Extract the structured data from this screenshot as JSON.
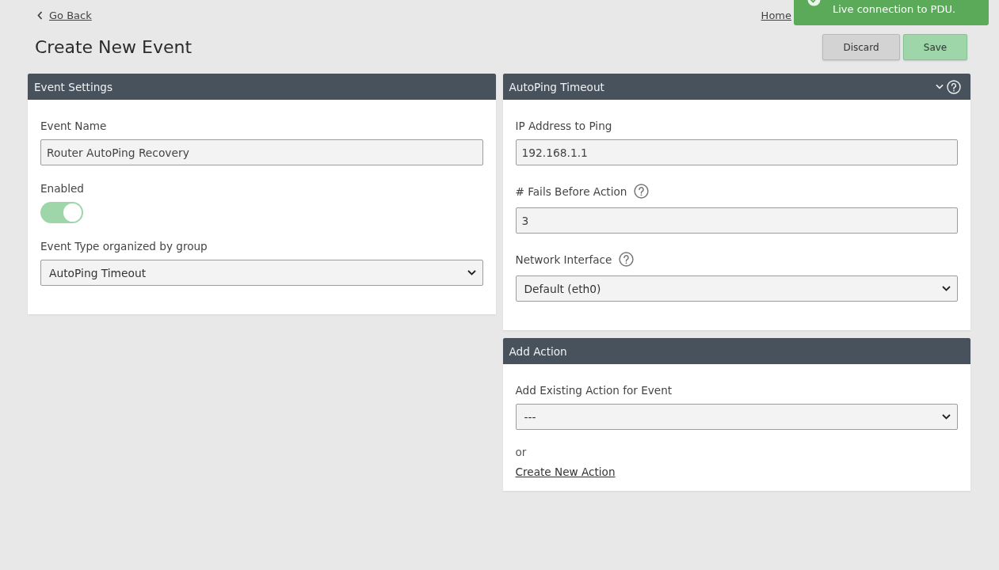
{
  "back_link": {
    "label": "Go Back"
  },
  "breadcrumb": [
    {
      "label": "Home"
    }
  ],
  "toast": {
    "kind": "success",
    "message": "Live connection to PDU."
  },
  "page_title": "Create New Event",
  "buttons": [
    {
      "kind": "secondary",
      "label": "Discard"
    },
    {
      "kind": "primary",
      "label": "Save"
    }
  ],
  "columns": [
    {
      "panels": [
        {
          "title": "Event Settings",
          "collapsible": false,
          "help": false,
          "fields": [
            {
              "kind": "text",
              "label": "Event Name",
              "help": false,
              "value": "Router AutoPing Recovery"
            },
            {
              "kind": "toggle",
              "label": "Enabled",
              "help": false,
              "on": true
            },
            {
              "kind": "select",
              "label": "Event Type organized by group",
              "help": false,
              "value": "AutoPing Timeout"
            }
          ]
        }
      ]
    },
    {
      "panels": [
        {
          "title": "AutoPing Timeout",
          "collapsible": true,
          "help": true,
          "fields": [
            {
              "kind": "text",
              "label": "IP Address to Ping",
              "help": false,
              "value": "192.168.1.1"
            },
            {
              "kind": "text",
              "label": "# Fails Before Action",
              "help": true,
              "value": "3"
            },
            {
              "kind": "select",
              "label": "Network Interface",
              "help": true,
              "value": "Default (eth0)"
            }
          ]
        },
        {
          "title": "Add Action",
          "collapsible": false,
          "help": false,
          "fields": [
            {
              "kind": "select",
              "label": "Add Existing Action for Event",
              "help": false,
              "value": "---"
            }
          ],
          "alternative": {
            "text": "or",
            "link": "Create New Action"
          }
        }
      ]
    }
  ]
}
